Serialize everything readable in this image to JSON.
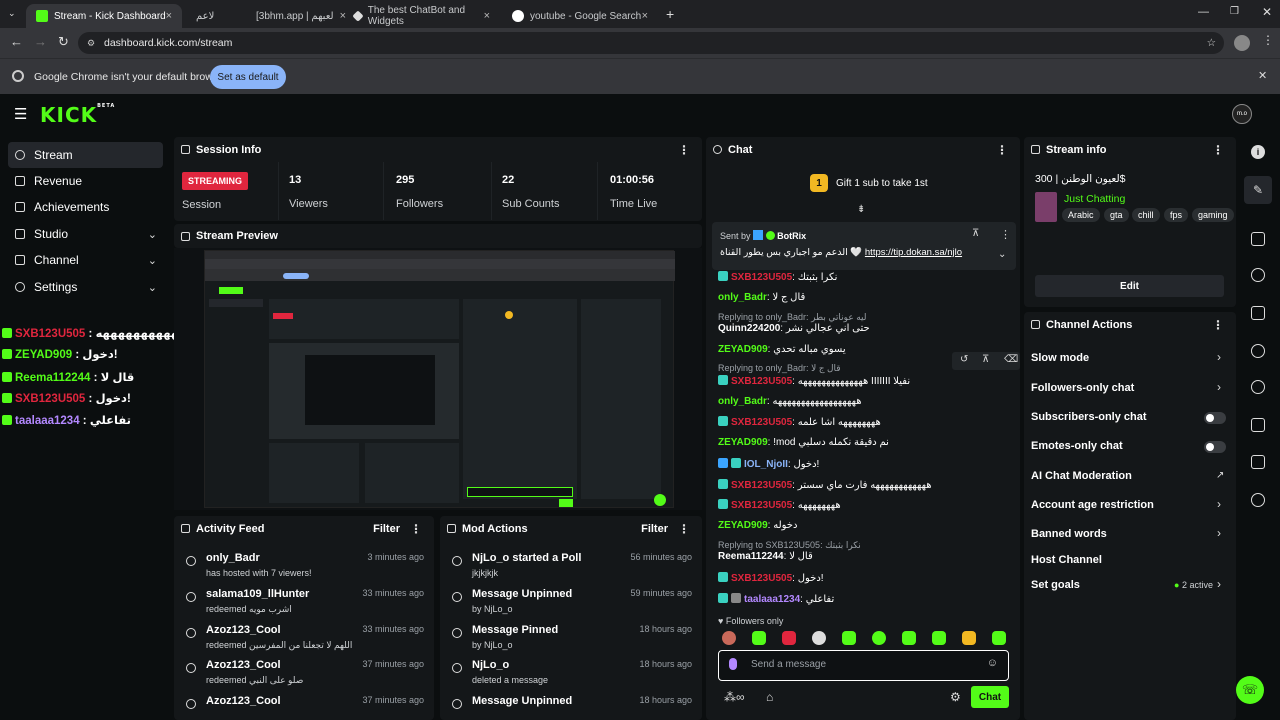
{
  "browser": {
    "tabs": [
      {
        "title": "Stream - Kick Dashboard",
        "close": "×"
      },
      {
        "title": "ﻻﻋﻢ",
        "close": ""
      },
      {
        "title": "[3bhm.app | لعبهم",
        "close": "×"
      },
      {
        "title": "The best ChatBot and Widgets",
        "close": "×"
      },
      {
        "title": "youtube - Google Search",
        "close": "×"
      }
    ],
    "new_tab": "+",
    "url": "dashboard.kick.com/stream",
    "infobar_text": "Google Chrome isn't your default browser",
    "set_default": "Set as default",
    "close_infobar": "✕"
  },
  "kick": {
    "logo": "KICK",
    "logo_beta": "BETA",
    "avatar_text": "m.o"
  },
  "sidebar": {
    "items": [
      {
        "label": "Stream",
        "chev": ""
      },
      {
        "label": "Revenue",
        "chev": ""
      },
      {
        "label": "Achievements",
        "chev": ""
      },
      {
        "label": "Studio",
        "chev": "⌄"
      },
      {
        "label": "Channel",
        "chev": "⌄"
      },
      {
        "label": "Settings",
        "chev": "⌄"
      }
    ]
  },
  "overlay_chat": [
    {
      "name": "SXB123U505",
      "msg": ": هههههههههههه",
      "color": "#e0263e"
    },
    {
      "name": "ZEYAD909",
      "msg": ": دخول!",
      "color": "#53fc18"
    },
    {
      "name": "Reema112244",
      "msg": ": قال لا",
      "color": "#53fc18"
    },
    {
      "name": "SXB123U505",
      "msg": ": دخول!",
      "color": "#e0263e"
    },
    {
      "name": "taalaaa1234",
      "msg": ": تفاعلي",
      "color": "#b388ff"
    }
  ],
  "session": {
    "title": "Session Info",
    "status": "STREAMING",
    "session_label": "Session",
    "stats": [
      {
        "value": "13",
        "label": "Viewers"
      },
      {
        "value": "295",
        "label": "Followers"
      },
      {
        "value": "22",
        "label": "Sub Counts"
      },
      {
        "value": "01:00:56",
        "label": "Time Live"
      }
    ]
  },
  "preview": {
    "title": "Stream Preview"
  },
  "activity": {
    "title": "Activity Feed",
    "filter": "Filter",
    "rows": [
      {
        "name": "only_Badr",
        "sub": "has hosted with 7 viewers!",
        "time": "3 minutes ago"
      },
      {
        "name": "salama109_llHunter",
        "sub": "redeemed اشرب مويه",
        "time": "33 minutes ago"
      },
      {
        "name": "Azoz123_Cool",
        "sub": "redeemed اللهم لا تجعلنا من المفرسين",
        "time": "33 minutes ago"
      },
      {
        "name": "Azoz123_Cool",
        "sub": "redeemed صلو على النبي",
        "time": "37 minutes ago"
      },
      {
        "name": "Azoz123_Cool",
        "sub": "",
        "time": "37 minutes ago"
      }
    ]
  },
  "modactions": {
    "title": "Mod Actions",
    "filter": "Filter",
    "rows": [
      {
        "name": "NjLo_o started a Poll",
        "sub": "jkjkjkjk",
        "time": "56 minutes ago"
      },
      {
        "name": "Message Unpinned",
        "sub": "by NjLo_o",
        "time": "59 minutes ago"
      },
      {
        "name": "Message Pinned",
        "sub": "by NjLo_o",
        "time": "18 hours ago"
      },
      {
        "name": "NjLo_o",
        "sub": "deleted a message",
        "time": "18 hours ago"
      },
      {
        "name": "Message Unpinned",
        "sub": "",
        "time": "18 hours ago"
      }
    ]
  },
  "chat": {
    "title": "Chat",
    "gift_text": "Gift 1 sub to take 1st",
    "gift_badge": "1",
    "pinned_sender": "Sent by",
    "pinned_bot": "BotRix",
    "pinned_msg": "الدعم مو اجباري بس يطور القناة 🤍",
    "pinned_link": "https://tip.dokan.sa/njlo",
    "lines": [
      {
        "kind": "msg",
        "name": "SXB123U505",
        "text": ": نكرا بثبتك",
        "color": "#e0263e"
      },
      {
        "kind": "msg",
        "name": "only_Badr",
        "text": ": قال ج لا",
        "color": "#53fc18"
      },
      {
        "kind": "reply",
        "text": "Replying to only_Badr: ليه عوناتي بطر"
      },
      {
        "kind": "msg",
        "name": "Quinn224200",
        "text": ": حتى اني عجالي نشر",
        "color": "#ffffff"
      },
      {
        "kind": "msg",
        "name": "ZEYAD909",
        "text": ": يسوي مباله تحدي",
        "color": "#53fc18"
      },
      {
        "kind": "reply",
        "text": "Replying to only_Badr: قال ج لا"
      },
      {
        "kind": "msg",
        "name": "SXB123U505",
        "text": ": ههههههههههههههه IIIIIII نفيلا",
        "color": "#e0263e"
      },
      {
        "kind": "msg",
        "name": "only_Badr",
        "text": ": ههههههههههههههههههه",
        "color": "#53fc18"
      },
      {
        "kind": "msg",
        "name": "SXB123U505",
        "text": ": ههههههههه اشا علمه",
        "color": "#e0263e"
      },
      {
        "kind": "msg",
        "name": "ZEYAD909",
        "text": ": !mod نم دقيقة نكمله دسلبي",
        "color": "#53fc18"
      },
      {
        "kind": "msg",
        "name": "IOL_NjoII",
        "text": ": دخول!",
        "color": "#8ab4f8"
      },
      {
        "kind": "msg",
        "name": "SXB123U505",
        "text": ": ههههههههههههه فارت ماي سستر",
        "color": "#e0263e"
      },
      {
        "kind": "msg",
        "name": "SXB123U505",
        "text": ": ههههههههه",
        "color": "#e0263e"
      },
      {
        "kind": "msg",
        "name": "ZEYAD909",
        "text": ": دخوله",
        "color": "#53fc18"
      },
      {
        "kind": "reply",
        "text": "Replying to SXB123U505: نكرا بثبتك"
      },
      {
        "kind": "msg",
        "name": "Reema112244",
        "text": ": قال لا",
        "color": "#ffffff"
      },
      {
        "kind": "msg",
        "name": "SXB123U505",
        "text": ": دخول!",
        "color": "#e0263e"
      },
      {
        "kind": "msg",
        "name": "taalaaa1234",
        "text": ": تفاعلي",
        "color": "#b388ff"
      }
    ],
    "followers_only": "Followers only",
    "input_placeholder": "Send a message",
    "send": "Chat"
  },
  "streaminfo": {
    "title": "Stream info",
    "stream_title": "لعيون الوطنن | 300$",
    "category": "Just Chatting",
    "tags": [
      "Arabic",
      "gta",
      "chill",
      "fps",
      "gaming"
    ],
    "edit": "Edit"
  },
  "channel_actions": {
    "title": "Channel Actions",
    "items": [
      {
        "label": "Slow mode",
        "control": "chevron"
      },
      {
        "label": "Followers-only chat",
        "control": "chevron"
      },
      {
        "label": "Subscribers-only chat",
        "control": "toggle"
      },
      {
        "label": "Emotes-only chat",
        "control": "toggle"
      },
      {
        "label": "AI Chat Moderation",
        "control": "external"
      },
      {
        "label": "Account age restriction",
        "control": "chevron"
      },
      {
        "label": "Banned words",
        "control": "chevron"
      },
      {
        "label": "Host Channel",
        "control": "none"
      },
      {
        "label": "Set goals",
        "control": "chevron"
      }
    ],
    "goals_active": "2 active"
  },
  "colors": {
    "brand": "#53fc18",
    "live": "#e0263e",
    "panel": "#141719"
  }
}
